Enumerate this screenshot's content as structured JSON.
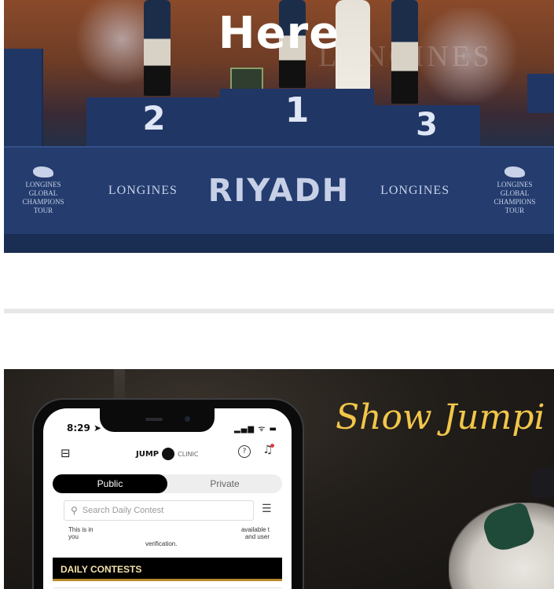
{
  "hero": {
    "title": "Here",
    "podium": [
      "2",
      "1",
      "3"
    ],
    "banner": {
      "city": "RIYADH",
      "sponsor": "LONGINES",
      "tour_name": "LONGINES",
      "tour_sub": "GLOBAL CHAMPIONS",
      "tour_tag": "TOUR"
    },
    "ghost_text": "LONGINES"
  },
  "promo": {
    "title": "Show Jumpi",
    "phone": {
      "time": "8:29",
      "status_icons": "▂▄▆ ᯤ ▬",
      "app_name": "JUMP",
      "app_name_2": "CLINIC",
      "tabs": [
        "Public",
        "Private"
      ],
      "search_placeholder": "Search Daily Contest",
      "notice_left": "This is in you",
      "notice_right": "available t and user",
      "notice_bottom": "verification.",
      "section_title": "DAILY CONTESTS"
    }
  }
}
